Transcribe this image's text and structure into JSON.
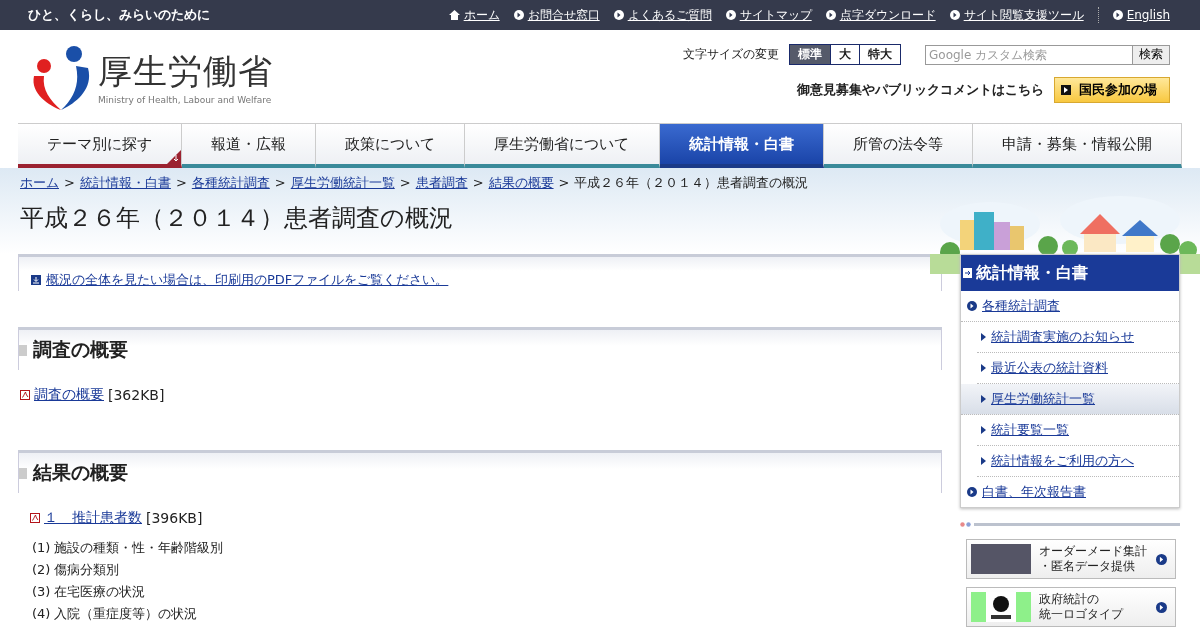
{
  "top_bar": {
    "tagline": "ひと、くらし、みらいのために",
    "links": [
      {
        "label": "ホーム",
        "kind": "home"
      },
      {
        "label": "お問合せ窓口",
        "kind": "arrow"
      },
      {
        "label": "よくあるご質問",
        "kind": "arrow"
      },
      {
        "label": "サイトマップ",
        "kind": "arrow"
      },
      {
        "label": "点字ダウンロード",
        "kind": "arrow"
      },
      {
        "label": "サイト閲覧支援ツール",
        "kind": "arrow"
      }
    ],
    "language_link": "English"
  },
  "header": {
    "logo_name": "厚生労働省",
    "logo_subtitle": "Ministry of Health, Labour and Welfare",
    "font_size_label": "文字サイズの変更",
    "font_sizes": [
      {
        "label": "標準",
        "selected": true
      },
      {
        "label": "大",
        "selected": false
      },
      {
        "label": "特大",
        "selected": false
      }
    ],
    "search": {
      "placeholder": "Google カスタム検索",
      "button": "検索"
    },
    "comment_text": "御意見募集やパブリックコメントはこちら",
    "participation_button": "国民参加の場"
  },
  "nav_tabs": [
    {
      "label": "テーマ別に探す",
      "kind": "menu",
      "selected": false
    },
    {
      "label": "報道・広報",
      "kind": "link",
      "selected": false
    },
    {
      "label": "政策について",
      "kind": "link",
      "selected": false
    },
    {
      "label": "厚生労働省について",
      "kind": "link",
      "selected": false
    },
    {
      "label": "統計情報・白書",
      "kind": "link",
      "selected": true
    },
    {
      "label": "所管の法令等",
      "kind": "link",
      "selected": false
    },
    {
      "label": "申請・募集・情報公開",
      "kind": "link",
      "selected": false
    }
  ],
  "breadcrumb": [
    {
      "label": "ホーム",
      "kind": "link"
    },
    {
      "separator": ">",
      "label": "統計情報・白書",
      "kind": "link"
    },
    {
      "separator": ">",
      "label": "各種統計調査",
      "kind": "link"
    },
    {
      "separator": ">",
      "label": "厚生労働統計一覧",
      "kind": "link"
    },
    {
      "separator": ">",
      "label": "患者調査",
      "kind": "link"
    },
    {
      "separator": ">",
      "label": "結果の概要",
      "kind": "link"
    },
    {
      "separator": ">",
      "label": "平成２６年（２０１４）患者調査の概況",
      "kind": "current"
    }
  ],
  "page_title": "平成２６年（２０１４）患者調査の概況",
  "pdf_notice": "概況の全体を見たい場合は、印刷用のPDFファイルをご覧ください。",
  "sections": [
    {
      "heading": "調査の概要",
      "items": [
        {
          "kind": "pdf",
          "link": "調査の概要",
          "size": "[362KB]"
        }
      ]
    },
    {
      "heading": "結果の概要",
      "items": [
        {
          "kind": "pdf",
          "link": "１　推計患者数",
          "size": "[396KB]"
        },
        {
          "kind": "text",
          "number": "(1)",
          "text": "施設の種類・性・年齢階級別"
        },
        {
          "kind": "text",
          "number": "(2)",
          "text": "傷病分類別"
        },
        {
          "kind": "text",
          "number": "(3)",
          "text": "在宅医療の状況"
        },
        {
          "kind": "text",
          "number": "(4)",
          "text": "入院（重症度等）の状況"
        }
      ]
    }
  ],
  "sidebar": {
    "title": "統計情報・白書",
    "items": [
      {
        "label": "各種統計調査",
        "selected": false,
        "children": [
          {
            "label": "統計調査実施のお知らせ",
            "selected": false
          },
          {
            "label": "最近公表の統計資料",
            "selected": false
          },
          {
            "label": "厚生労働統計一覧",
            "selected": true
          },
          {
            "label": "統計要覧一覧",
            "selected": false
          },
          {
            "label": "統計情報をご利用の方へ",
            "selected": false
          }
        ]
      },
      {
        "label": "白書、年次報告書",
        "selected": false
      }
    ]
  },
  "banners": [
    {
      "lines": [
        "オーダーメード集計",
        "・匿名データ提供"
      ],
      "kind": "keyboard"
    },
    {
      "lines": [
        "政府統計の",
        "統一ロゴタイプ"
      ],
      "kind": "logo"
    }
  ]
}
